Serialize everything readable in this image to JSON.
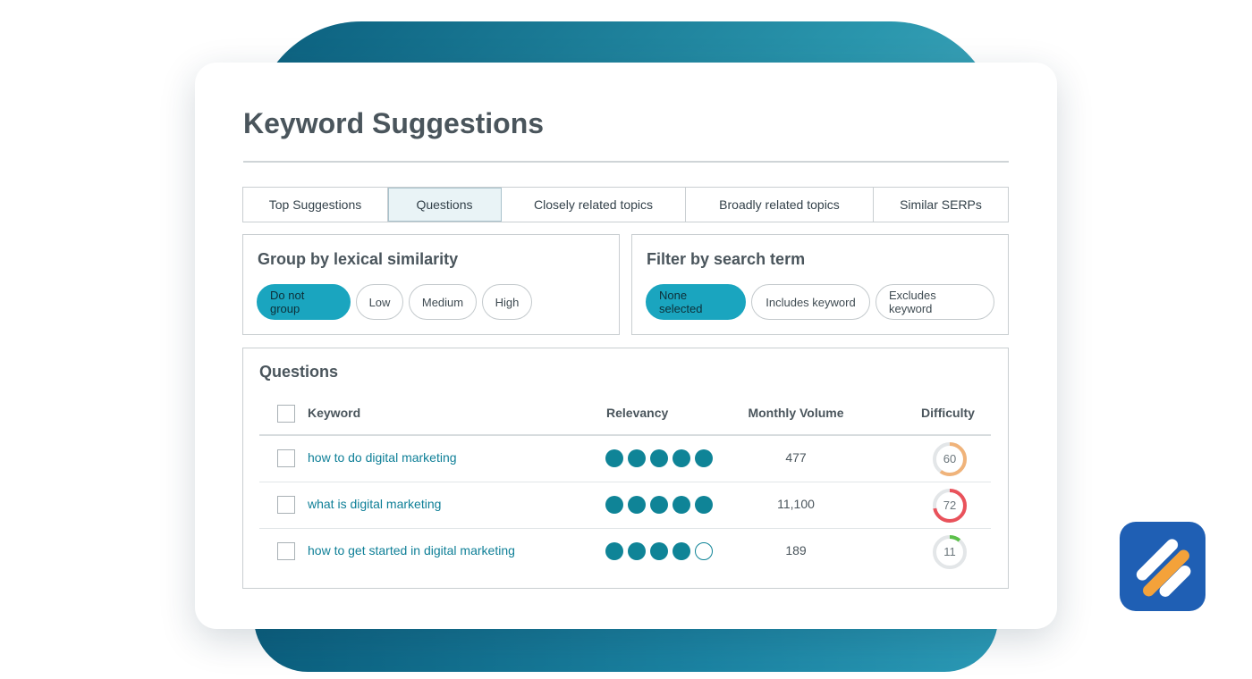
{
  "header": {
    "title": "Keyword Suggestions"
  },
  "tabs": [
    {
      "label": "Top Suggestions",
      "active": false
    },
    {
      "label": "Questions",
      "active": true
    },
    {
      "label": "Closely related topics",
      "active": false
    },
    {
      "label": "Broadly related topics",
      "active": false
    },
    {
      "label": "Similar SERPs",
      "active": false
    }
  ],
  "group_panel": {
    "title": "Group by lexical similarity",
    "options": [
      "Do not group",
      "Low",
      "Medium",
      "High"
    ],
    "selected": "Do not group"
  },
  "filter_panel": {
    "title": "Filter by search term",
    "options": [
      "None selected",
      "Includes keyword",
      "Excludes keyword"
    ],
    "selected": "None selected"
  },
  "table": {
    "title": "Questions",
    "headers": {
      "keyword": "Keyword",
      "relevancy": "Relevancy",
      "volume": "Monthly Volume",
      "difficulty": "Difficulty"
    },
    "rows": [
      {
        "keyword": "how to do digital marketing",
        "relevancy": 5,
        "volume": "477",
        "difficulty": "60"
      },
      {
        "keyword": "what is digital marketing",
        "relevancy": 5,
        "volume": "11,100",
        "difficulty": "72"
      },
      {
        "keyword": "how to get started in digital marketing",
        "relevancy": 4,
        "volume": "189",
        "difficulty": "11"
      }
    ],
    "relevancy_max": 5
  },
  "colors": {
    "accent": "#1aa5bf",
    "dot": "#0f8497",
    "link": "#0e7f97",
    "difficulty_medium": "#f0b37a",
    "difficulty_high": "#e9525b",
    "difficulty_low": "#5cc04a",
    "ring_track": "#e3e6e8"
  },
  "logo": {
    "icon": "brand-stripes-icon"
  }
}
